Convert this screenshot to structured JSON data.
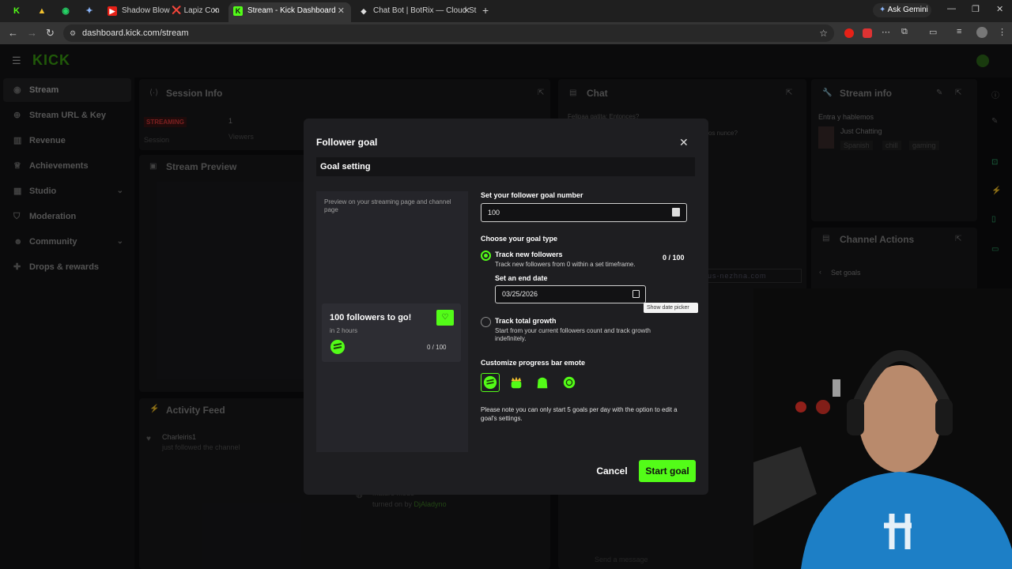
{
  "browser": {
    "tabs": [
      {
        "title": "Shadow Blow ❌ Lapiz Con",
        "favicon_color": "#e62117"
      },
      {
        "title": "Stream - Kick Dashboard",
        "favicon_color": "#53fc18"
      },
      {
        "title": "Chat Bot | BotRix — Cloud Stre",
        "favicon_color": "#dddddd"
      }
    ],
    "ask_gemini": "Ask Gemini",
    "url": "dashboard.kick.com/stream"
  },
  "dashboard": {
    "logo": "KICK",
    "sidebar": [
      {
        "label": "Stream",
        "icon": "broadcast-icon"
      },
      {
        "label": "Stream URL & Key",
        "icon": "globe-icon"
      },
      {
        "label": "Revenue",
        "icon": "chart-icon"
      },
      {
        "label": "Achievements",
        "icon": "trophy-icon"
      },
      {
        "label": "Studio",
        "icon": "grid-icon"
      },
      {
        "label": "Moderation",
        "icon": "shield-icon"
      },
      {
        "label": "Community",
        "icon": "people-icon"
      },
      {
        "label": "Drops & rewards",
        "icon": "gift-icon"
      }
    ],
    "session_info": {
      "title": "Session Info",
      "status": "STREAMING",
      "session": "Session",
      "viewers_value": "1",
      "viewers_label": "Viewers"
    },
    "stream_preview": {
      "title": "Stream Preview"
    },
    "chat": {
      "title": "Chat",
      "message": "Felipaa gatita: Entonces?",
      "message2": "os nunce?",
      "send_placeholder": "Send a message"
    },
    "stream_info": {
      "title": "Stream info",
      "stream_title": "Entra y hablemos",
      "category": "Just Chatting",
      "tags": [
        "Spanish",
        "chill",
        "gaming"
      ]
    },
    "channel_actions": {
      "title": "Channel Actions",
      "set_goals": "Set goals"
    },
    "activity_feed": {
      "title": "Activity Feed",
      "user": "Charleiris1",
      "event": "just followed the channel",
      "feed2_title": "Mature mode",
      "feed2_sub_prefix": "turned on by ",
      "feed2_user": "DjAladyno"
    },
    "banner_text": "us-nezhna.com"
  },
  "modal": {
    "title": "Follower goal",
    "section": "Goal setting",
    "preview_label": "Preview on your streaming page and channel page",
    "preview_card": {
      "title": "100 followers to go!",
      "subtitle": "in 2 hours",
      "count": "0 / 100"
    },
    "goal_number_label": "Set your follower goal number",
    "goal_number_value": "100",
    "goal_type_label": "Choose your goal type",
    "option1": {
      "title": "Track new followers",
      "description": "Track new followers from 0 within a set timeframe.",
      "count": "0 / 100",
      "selected": true
    },
    "end_date_label": "Set an end date",
    "end_date_value": "03/25/2026",
    "date_tooltip": "Show date picker",
    "option2": {
      "title": "Track total growth",
      "description": "Start from your current followers count and track growth indefinitely.",
      "selected": false
    },
    "emote_label": "Customize progress bar emote",
    "emotes": [
      "kick-face-emote-icon",
      "crown-emote-icon",
      "blob-emote-icon",
      "globe-emote-icon"
    ],
    "note": "Please note you can only start 5 goals per day with the option to edit a goal's settings.",
    "cancel": "Cancel",
    "start": "Start goal"
  },
  "colors": {
    "accent": "#53fc18",
    "modal_bg": "#1e1e21",
    "streaming": "#e03b3b"
  }
}
